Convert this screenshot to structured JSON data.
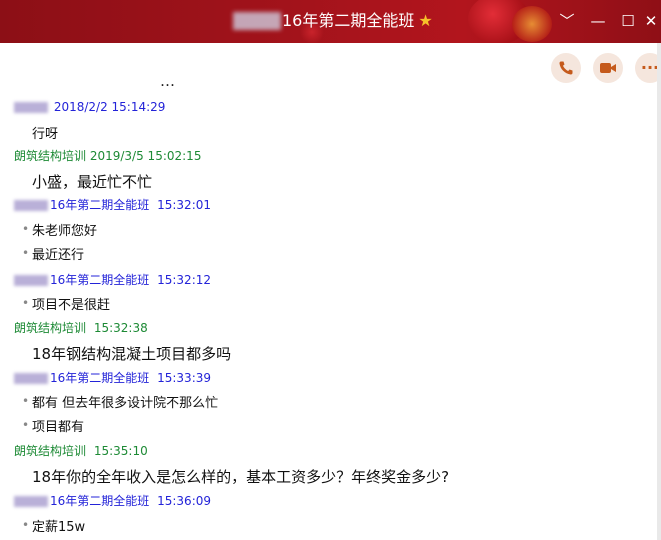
{
  "window": {
    "title": "16年第二期全能班",
    "title_star": "★",
    "minimize_glyph": "—",
    "restore_glyph": "☐",
    "close_glyph": "✕",
    "menu_glyph": "﹀",
    "titlebar_color": "#a3131b"
  },
  "toolbar": {
    "icons": [
      "phone-icon",
      "video-call-icon",
      "more-icon"
    ],
    "more_glyph": "···"
  },
  "messages": [
    {
      "sender": "",
      "time": "2018/2/2 15:14:29",
      "color": "blue",
      "lines": [
        "行呀"
      ]
    },
    {
      "sender": "朗筑结构培训",
      "time": "2019/3/5 15:02:15",
      "color": "green",
      "lines": [
        "小盛，最近忙不忙"
      ]
    },
    {
      "sender": "16年第二期全能班",
      "time": "15:32:01",
      "color": "blue",
      "lines": [
        "朱老师您好",
        "最近还行"
      ]
    },
    {
      "sender": "16年第二期全能班",
      "time": "15:32:12",
      "color": "blue",
      "lines": [
        "项目不是很赶"
      ]
    },
    {
      "sender": "朗筑结构培训",
      "time": "15:32:38",
      "color": "green",
      "lines": [
        "18年钢结构混凝土项目都多吗"
      ]
    },
    {
      "sender": "16年第二期全能班",
      "time": "15:33:39",
      "color": "blue",
      "lines": [
        "都有 但去年很多设计院不那么忙",
        "项目都有"
      ]
    },
    {
      "sender": "朗筑结构培训",
      "time": "15:35:10",
      "color": "green",
      "lines": [
        "18年你的全年收入是怎么样的，基本工资多少？年终奖金多少?"
      ]
    },
    {
      "sender": "16年第二期全能班",
      "time": "15:36:09",
      "color": "blue",
      "lines": [
        "定薪15w"
      ]
    }
  ]
}
